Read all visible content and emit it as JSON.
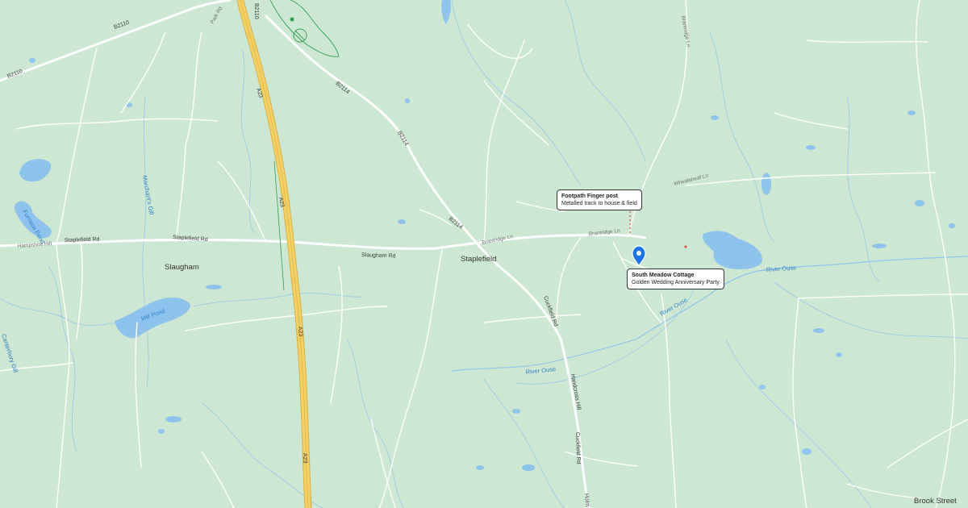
{
  "map": {
    "colors": {
      "land": "#cce8d2",
      "water": "#8ec3ee",
      "motorway": "#f4cf66",
      "road": "#ffffff",
      "marker": "#1a73e8",
      "woodland_outline": "#2e9e4f"
    },
    "places": [
      {
        "id": "staplefield",
        "name": "Staplefield"
      },
      {
        "id": "slaugham",
        "name": "Slaugham"
      },
      {
        "id": "brook-street",
        "name": "Brook Street"
      }
    ],
    "roads": [
      {
        "id": "a23-1",
        "name": "A23"
      },
      {
        "id": "a23-2",
        "name": "A23"
      },
      {
        "id": "a23-3",
        "name": "A23"
      },
      {
        "id": "a23-4",
        "name": "A23"
      },
      {
        "id": "b2114-1",
        "name": "B2114"
      },
      {
        "id": "b2114-2",
        "name": "B2114"
      },
      {
        "id": "b2114-3",
        "name": "B2114"
      },
      {
        "id": "b2110-1",
        "name": "B2110"
      },
      {
        "id": "b2110-2",
        "name": "B2110"
      },
      {
        "id": "b2110-3",
        "name": "B2110"
      },
      {
        "id": "staplefield-rd-1",
        "name": "Staplefield Rd"
      },
      {
        "id": "staplefield-rd-2",
        "name": "Staplefield Rd"
      },
      {
        "id": "slaugham-rd",
        "name": "Slaugham Rd"
      },
      {
        "id": "hampshire-hill",
        "name": "Hampshire Hill"
      },
      {
        "id": "brantridge-ln-1",
        "name": "Brantridge Ln"
      },
      {
        "id": "brantridge-ln-2",
        "name": "Brantridge Ln"
      },
      {
        "id": "brantridge-ln-3",
        "name": "Brantridge Ln"
      },
      {
        "id": "cuckfield-rd-1",
        "name": "Cuckfield Rd"
      },
      {
        "id": "cuckfield-rd-2",
        "name": "Cuckfield Rd"
      },
      {
        "id": "handcross-hill",
        "name": "Handcross Hill"
      },
      {
        "id": "wheatsheaf-ln",
        "name": "Wheatsheaf Ln"
      },
      {
        "id": "park-rd",
        "name": "Park Rd"
      },
      {
        "id": "hole",
        "name": "Holm"
      }
    ],
    "water": [
      {
        "id": "river-ouse-1",
        "name": "River Ouse"
      },
      {
        "id": "river-ouse-2",
        "name": "River Ouse"
      },
      {
        "id": "river-ouse-3",
        "name": "River Ouse"
      },
      {
        "id": "mill-pond",
        "name": "Mill Pond"
      },
      {
        "id": "furnace-pond",
        "name": "Furnace Pond"
      },
      {
        "id": "marchants-gill",
        "name": "Marchant's Gill"
      },
      {
        "id": "cantebury-gill",
        "name": "Canterbury Gill"
      }
    ],
    "markers": [
      {
        "id": "footpath-post",
        "title": "Footpath Finger post",
        "subtitle": "Metalled track to house & field"
      },
      {
        "id": "south-meadow",
        "title": "South Meadow Cottage",
        "subtitle": "Golden Wedding Anniversary Party",
        "icon": "map-pin-icon"
      }
    ]
  }
}
